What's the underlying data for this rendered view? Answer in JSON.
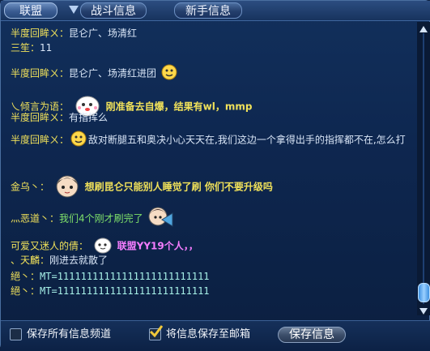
{
  "tabs": [
    {
      "label": "联盟"
    },
    {
      "label": "战斗信息"
    },
    {
      "label": "新手信息"
    }
  ],
  "messages": [
    {
      "sender": "半度回眸ㄨ：",
      "text": "昆仑广、场清红"
    },
    {
      "sender": "三笙：",
      "text": "11"
    },
    {
      "sender": "半度回眸ㄨ：",
      "text": "昆仑广、场清红进团"
    },
    {
      "sender": "乀倾言为语：",
      "text": "刚准备去自爆，结果有wl，mmp"
    },
    {
      "sender": "半度回眸ㄨ：",
      "text": "有指挥么"
    },
    {
      "sender": "半度回眸ㄨ：",
      "text": "敌对断腿五和奥决小心天天在,我们这边一个拿得出手的指挥都不在,怎么打"
    },
    {
      "sender": "金乌丶：",
      "text": "想刷昆仑只能别人睡觉了刷 你们不要升级吗"
    },
    {
      "sender": "灬恶道丶：",
      "text": "我们4个刚才刷完了"
    },
    {
      "sender": "可爱又迷人的倩：",
      "text": "联盟YY19个人，，"
    },
    {
      "sender": "、天麟：",
      "text": "刚进去就散了"
    },
    {
      "sender": "絕丶：",
      "text": "MT=11111111111111111111111111"
    },
    {
      "sender": "絕丶：",
      "text": "MT=11111111111111111111111111"
    }
  ],
  "bottom": {
    "save_all_channels_label": "保存所有信息频道",
    "save_all_channels_checked": false,
    "save_to_mail_label": "将信息保存至邮箱",
    "save_to_mail_checked": true,
    "save_button_label": "保存信息"
  },
  "colors": {
    "sender": "#f0e15a",
    "text": "#d9e6f7",
    "highlight_yellow": "#f0e15a",
    "highlight_green": "#7fe06a",
    "highlight_pink": "#f57dff"
  },
  "icons": [
    "dropdown-arrow-icon",
    "smile-emoji-icon",
    "chibi-avatar-icon",
    "fan-emoji-icon",
    "ghost-emoji-icon",
    "scroll-up-icon",
    "scroll-down-icon",
    "checkmark-icon"
  ]
}
